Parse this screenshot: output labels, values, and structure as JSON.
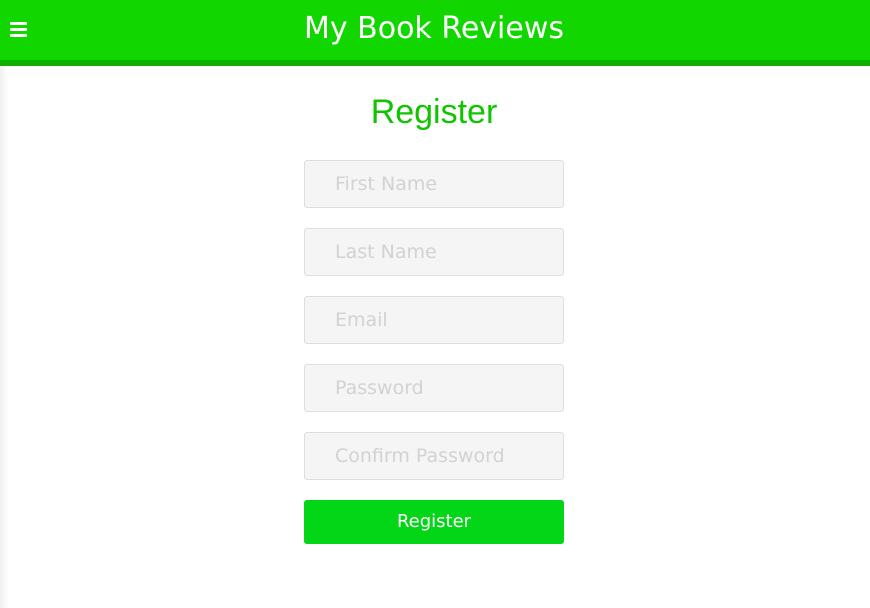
{
  "header": {
    "title": "My Book Reviews",
    "menu_icon": "hamburger-menu-icon",
    "background_color": "#11d600",
    "border_color": "#0eb100"
  },
  "form": {
    "title": "Register",
    "title_color": "#11c400",
    "fields": [
      {
        "name": "first-name",
        "placeholder": "First Name",
        "value": ""
      },
      {
        "name": "last-name",
        "placeholder": "Last Name",
        "value": ""
      },
      {
        "name": "email",
        "placeholder": "Email",
        "value": ""
      },
      {
        "name": "password",
        "placeholder": "Password",
        "value": ""
      },
      {
        "name": "confirm-password",
        "placeholder": "Confirm Password",
        "value": ""
      }
    ],
    "submit_label": "Register",
    "submit_color": "#03d616"
  }
}
